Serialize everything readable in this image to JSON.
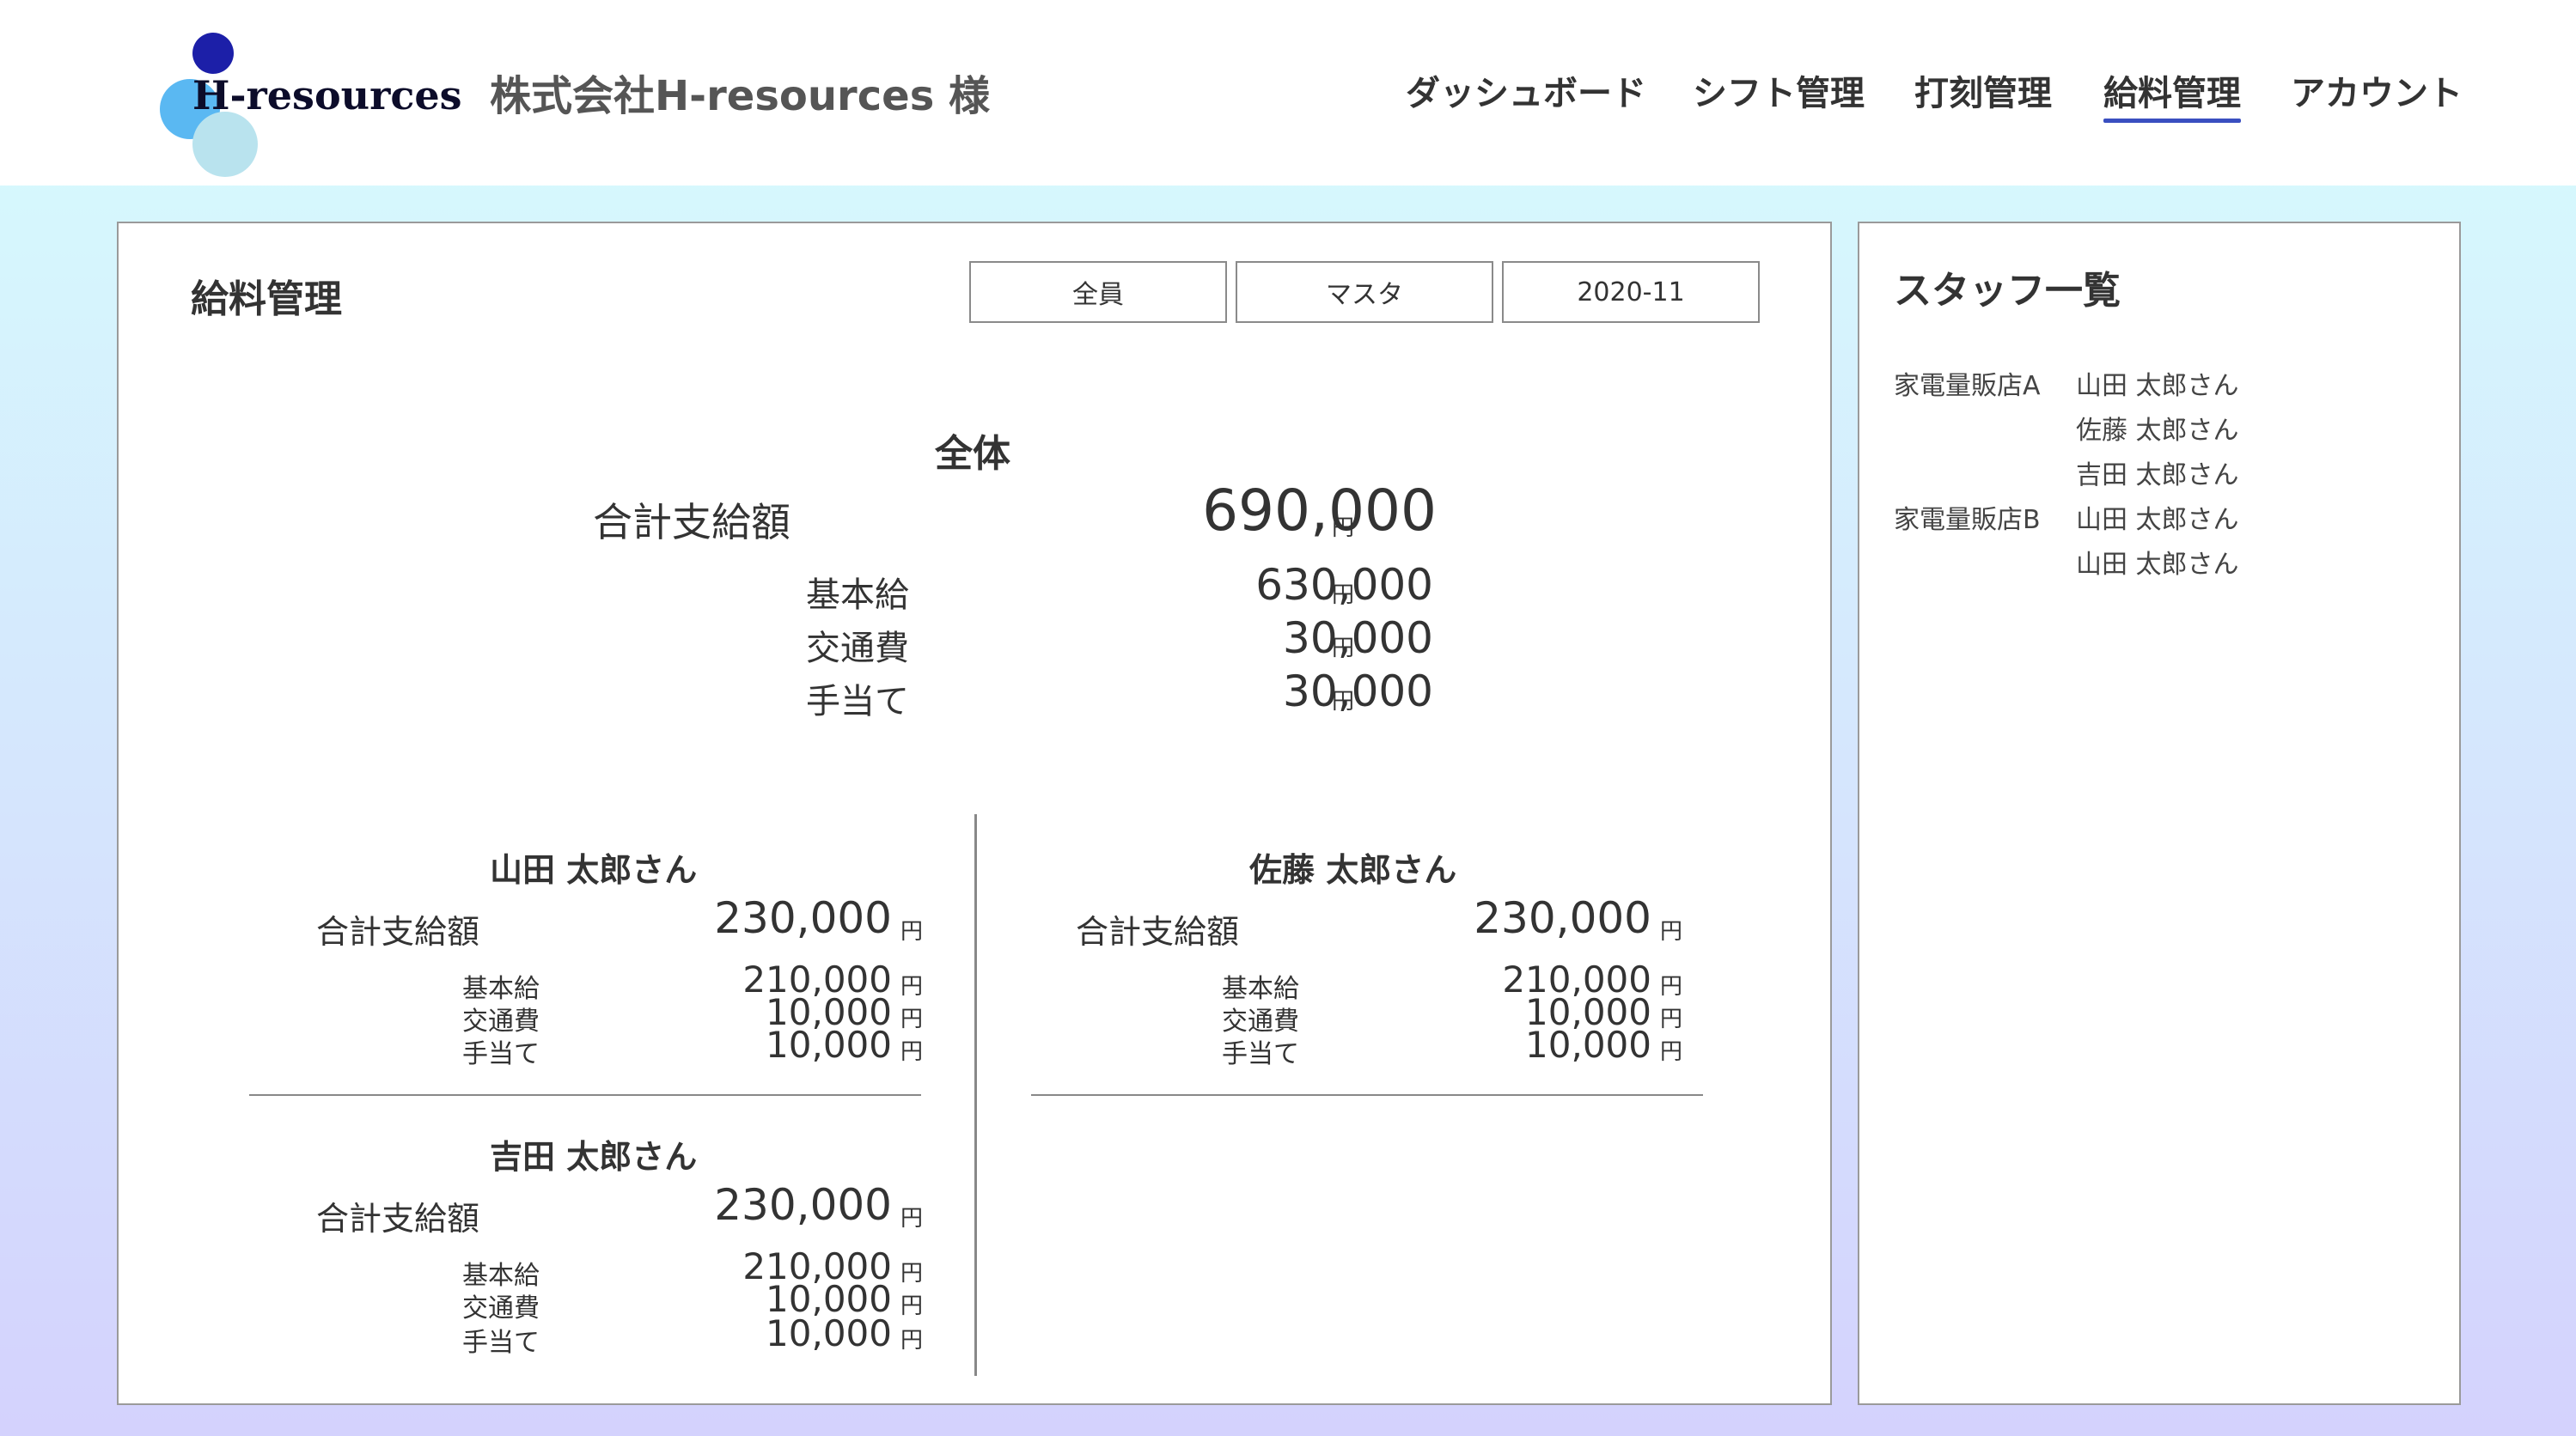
{
  "header": {
    "logo_text": "H-resources",
    "company": "株式会社H-resources 様",
    "nav": [
      {
        "label": "ダッシュボード"
      },
      {
        "label": "シフト管理"
      },
      {
        "label": "打刻管理"
      },
      {
        "label": "給料管理",
        "active": true
      },
      {
        "label": "アカウント"
      }
    ],
    "accent_color": "#3a4fc0"
  },
  "main": {
    "title": "給料管理",
    "filters": [
      "全員",
      "マスタ",
      "2020-11"
    ],
    "overall": {
      "heading": "全体",
      "total_label": "合計支給額",
      "total_value": "690,000",
      "rows": [
        {
          "label": "基本給",
          "value": "630,000"
        },
        {
          "label": "交通費",
          "value": "30,000"
        },
        {
          "label": "手当て",
          "value": "30,000"
        }
      ],
      "unit": "円"
    },
    "staff": [
      {
        "name": "山田 太郎さん",
        "total_label": "合計支給額",
        "total_value": "230,000",
        "rows": [
          {
            "label": "基本給",
            "value": "210,000"
          },
          {
            "label": "交通費",
            "value": "10,000"
          },
          {
            "label": "手当て",
            "value": "10,000"
          }
        ],
        "unit": "円"
      },
      {
        "name": "佐藤 太郎さん",
        "total_label": "合計支給額",
        "total_value": "230,000",
        "rows": [
          {
            "label": "基本給",
            "value": "210,000"
          },
          {
            "label": "交通費",
            "value": "10,000"
          },
          {
            "label": "手当て",
            "value": "10,000"
          }
        ],
        "unit": "円"
      },
      {
        "name": "吉田 太郎さん",
        "total_label": "合計支給額",
        "total_value": "230,000",
        "rows": [
          {
            "label": "基本給",
            "value": "210,000"
          },
          {
            "label": "交通費",
            "value": "10,000"
          },
          {
            "label": "手当て",
            "value": "10,000"
          }
        ],
        "unit": "円"
      }
    ]
  },
  "sidebar": {
    "title": "スタッフ一覧",
    "groups": [
      {
        "store": "家電量販店A",
        "staff": [
          "山田 太郎さん",
          "佐藤 太郎さん",
          "吉田 太郎さん"
        ]
      },
      {
        "store": "家電量販店B",
        "staff": [
          "山田 太郎さん",
          "山田 太郎さん"
        ]
      }
    ]
  }
}
